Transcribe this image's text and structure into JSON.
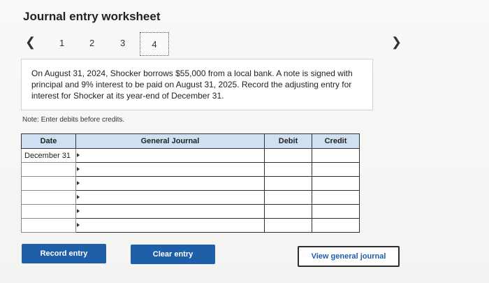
{
  "title": "Journal entry worksheet",
  "nav": {
    "prev_icon": "chevron-left",
    "next_icon": "chevron-right",
    "steps": [
      "1",
      "2",
      "3",
      "4"
    ],
    "active_step": "4"
  },
  "question": "On August 31, 2024, Shocker borrows $55,000 from a local bank. A note is signed with principal and 9% interest to be paid on August 31, 2025. Record the adjusting entry for interest for Shocker at its year-end of December 31.",
  "note": "Note: Enter debits before credits.",
  "table": {
    "headers": [
      "Date",
      "General Journal",
      "Debit",
      "Credit"
    ],
    "rows": [
      {
        "date": "December 31",
        "account": "",
        "debit": "",
        "credit": ""
      },
      {
        "date": "",
        "account": "",
        "debit": "",
        "credit": ""
      },
      {
        "date": "",
        "account": "",
        "debit": "",
        "credit": ""
      },
      {
        "date": "",
        "account": "",
        "debit": "",
        "credit": ""
      },
      {
        "date": "",
        "account": "",
        "debit": "",
        "credit": ""
      },
      {
        "date": "",
        "account": "",
        "debit": "",
        "credit": ""
      }
    ]
  },
  "buttons": {
    "record": "Record entry",
    "clear": "Clear entry",
    "view": "View general journal"
  },
  "colors": {
    "primary": "#1f5fa8",
    "header_bg": "#cfe0f3"
  }
}
